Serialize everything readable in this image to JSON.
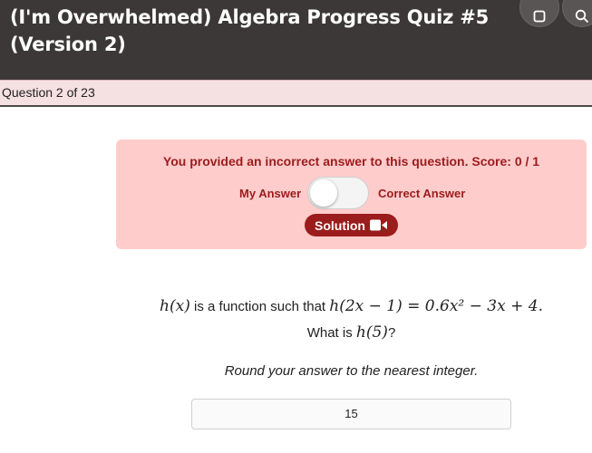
{
  "header": {
    "title": "(I'm Overwhelmed) Algebra Progress Quiz #5 (Version 2)",
    "buttons": [
      {
        "name": "square-icon"
      },
      {
        "name": "search-icon"
      }
    ]
  },
  "question_bar": {
    "label": "Question 2 of 23"
  },
  "feedback": {
    "message": "You provided an incorrect answer to this question. Score: 0 / 1",
    "toggle_left_label": "My Answer",
    "toggle_right_label": "Correct Answer",
    "toggle_state": "My Answer",
    "solution_label": "Solution",
    "colors": {
      "panel_bg": "#ffcccc",
      "accent": "#9b1c1c"
    }
  },
  "question": {
    "fn": "h(x)",
    "text_mid": " is a function such that ",
    "equation": "h(2x − 1) = 0.6x² − 3x + 4.",
    "ask_prefix": "What is ",
    "ask_expr": "h(5)",
    "ask_suffix": "?",
    "instruction": "Round your answer to the nearest integer."
  },
  "answer": {
    "value": "15"
  }
}
